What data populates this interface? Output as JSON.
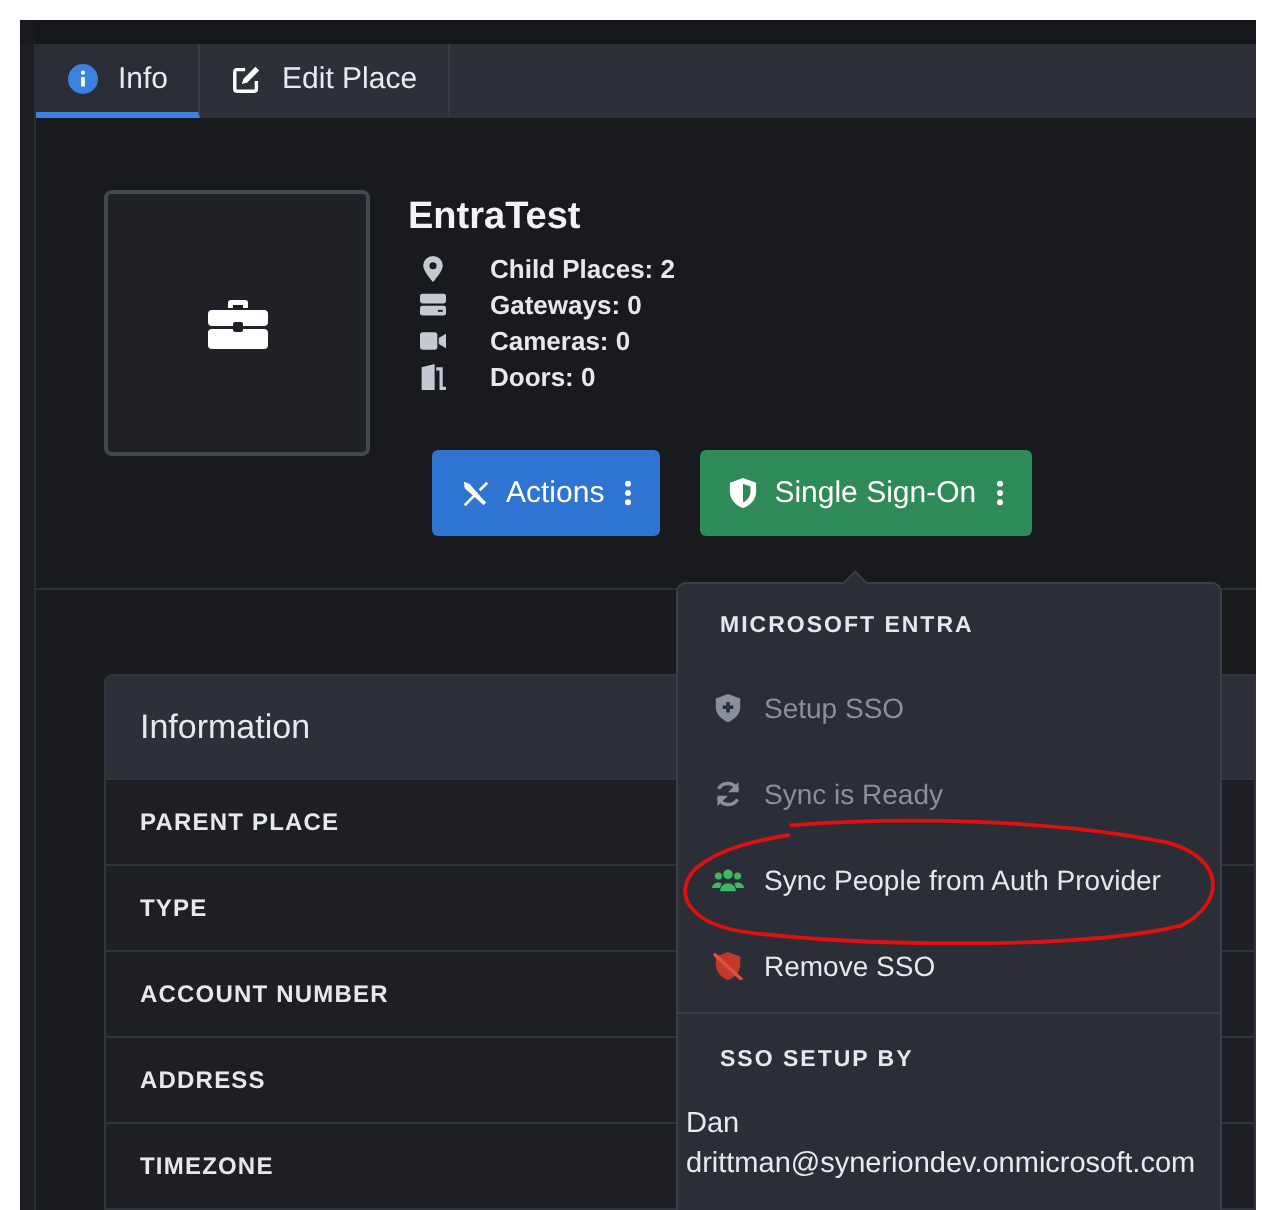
{
  "tabs": [
    {
      "label": "Info",
      "selected": true
    },
    {
      "label": "Edit Place",
      "selected": false
    }
  ],
  "place": {
    "name": "EntraTest",
    "stats": [
      {
        "text": "Child Places: 2"
      },
      {
        "text": "Gateways: 0"
      },
      {
        "text": "Cameras: 0"
      },
      {
        "text": "Doors: 0"
      }
    ]
  },
  "buttons": [
    {
      "kind": "actions",
      "label": "Actions"
    },
    {
      "kind": "sso",
      "label": "Single Sign-On"
    }
  ],
  "information": {
    "title": "Information",
    "rows": [
      "PARENT PLACE",
      "TYPE",
      "ACCOUNT NUMBER",
      "ADDRESS",
      "TIMEZONE"
    ]
  },
  "sso_menu": {
    "header": "MICROSOFT ENTRA",
    "items": [
      {
        "label": "Setup SSO",
        "disabled": true
      },
      {
        "label": "Sync is Ready",
        "disabled": true
      },
      {
        "label": "Sync People from Auth Provider",
        "disabled": false
      },
      {
        "label": "Remove SSO",
        "disabled": false
      }
    ],
    "setup_by_header": "SSO SETUP BY",
    "setup_by_name": "Dan",
    "setup_by_email": "drittman@syneriondev.onmicrosoft.com"
  }
}
